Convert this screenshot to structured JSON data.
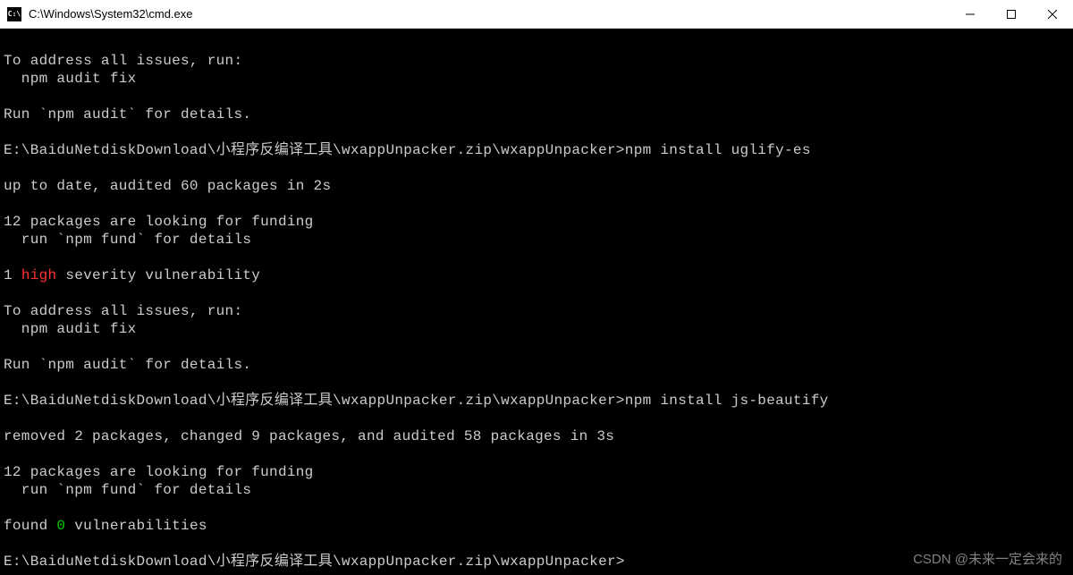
{
  "window": {
    "title": "C:\\Windows\\System32\\cmd.exe",
    "icon_label": "C:\\"
  },
  "terminal": {
    "lines": [
      {
        "t": ""
      },
      {
        "t": "To address all issues, run:"
      },
      {
        "t": "  npm audit fix"
      },
      {
        "t": ""
      },
      {
        "t": "Run `npm audit` for details."
      },
      {
        "t": ""
      },
      {
        "t": "E:\\BaiduNetdiskDownload\\小程序反编译工具\\wxappUnpacker.zip\\wxappUnpacker>npm install uglify-es"
      },
      {
        "t": ""
      },
      {
        "t": "up to date, audited 60 packages in 2s"
      },
      {
        "t": ""
      },
      {
        "t": "12 packages are looking for funding"
      },
      {
        "t": "  run `npm fund` for details"
      },
      {
        "t": ""
      },
      {
        "segments": [
          {
            "t": "1 "
          },
          {
            "t": "high",
            "cls": "red"
          },
          {
            "t": " severity vulnerability"
          }
        ]
      },
      {
        "t": ""
      },
      {
        "t": "To address all issues, run:"
      },
      {
        "t": "  npm audit fix"
      },
      {
        "t": ""
      },
      {
        "t": "Run `npm audit` for details."
      },
      {
        "t": ""
      },
      {
        "t": "E:\\BaiduNetdiskDownload\\小程序反编译工具\\wxappUnpacker.zip\\wxappUnpacker>npm install js-beautify"
      },
      {
        "t": ""
      },
      {
        "t": "removed 2 packages, changed 9 packages, and audited 58 packages in 3s"
      },
      {
        "t": ""
      },
      {
        "t": "12 packages are looking for funding"
      },
      {
        "t": "  run `npm fund` for details"
      },
      {
        "t": ""
      },
      {
        "segments": [
          {
            "t": "found "
          },
          {
            "t": "0",
            "cls": "green"
          },
          {
            "t": " vulnerabilities"
          }
        ]
      },
      {
        "t": ""
      },
      {
        "t": "E:\\BaiduNetdiskDownload\\小程序反编译工具\\wxappUnpacker.zip\\wxappUnpacker>"
      }
    ]
  },
  "watermark": "CSDN @未来一定会来的"
}
